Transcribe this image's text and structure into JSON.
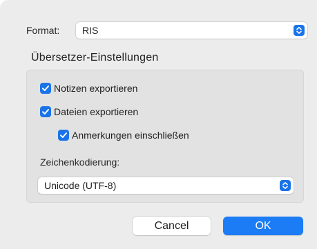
{
  "format": {
    "label": "Format:",
    "value": "RIS"
  },
  "section_title": "Übersetzer-Einstellungen",
  "options": {
    "export_notes": {
      "label": "Notizen exportieren",
      "checked": true
    },
    "export_files": {
      "label": "Dateien exportieren",
      "checked": true
    },
    "include_annotations": {
      "label": "Anmerkungen einschließen",
      "checked": true
    }
  },
  "encoding": {
    "label": "Zeichenkodierung:",
    "value": "Unicode (UTF-8)"
  },
  "buttons": {
    "cancel": "Cancel",
    "ok": "OK"
  },
  "colors": {
    "accent": "#1a73e8",
    "ok_button": "#1c7cf5"
  },
  "icons": {
    "select_stepper": "chevron-updown-icon",
    "checkbox_mark": "checkmark-icon"
  }
}
